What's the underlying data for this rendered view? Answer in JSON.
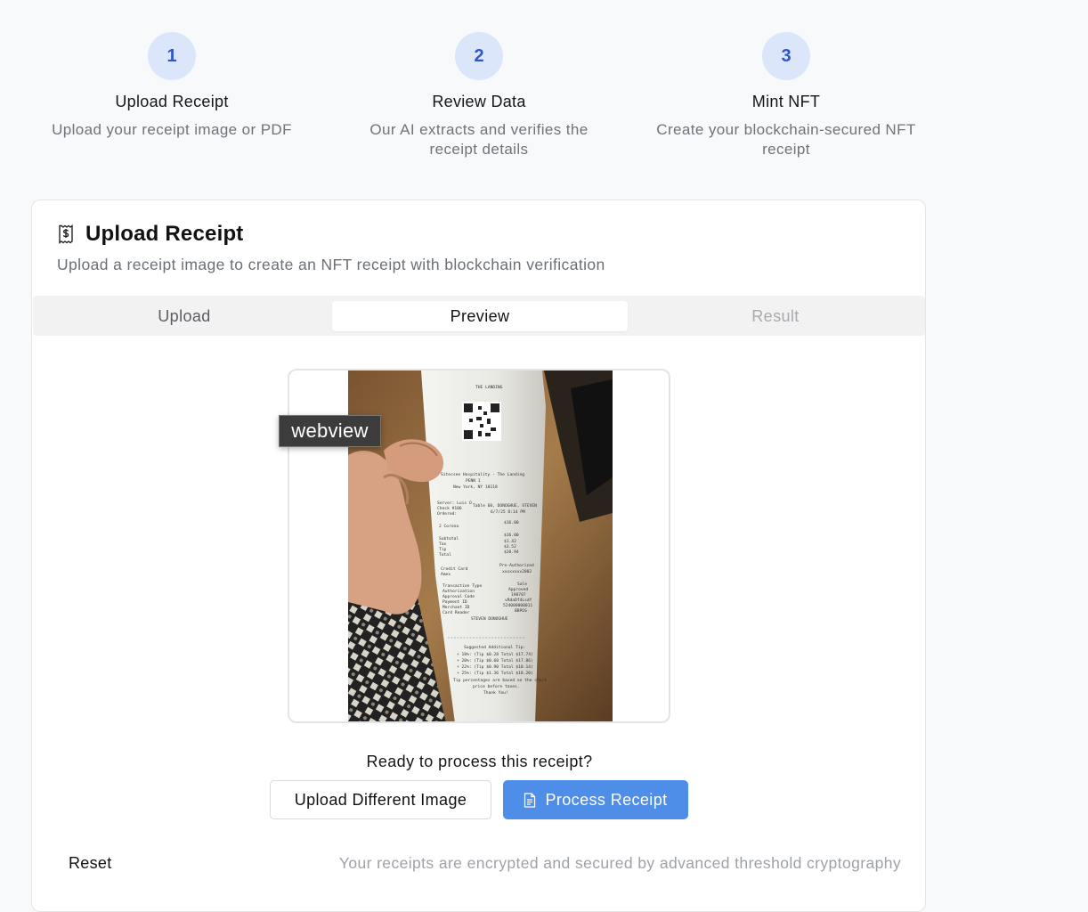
{
  "steps": [
    {
      "number": "1",
      "title": "Upload Receipt",
      "description": "Upload your receipt image or PDF"
    },
    {
      "number": "2",
      "title": "Review Data",
      "description": "Our AI extracts and verifies the receipt details"
    },
    {
      "number": "3",
      "title": "Mint NFT",
      "description": "Create your blockchain-secured NFT receipt"
    }
  ],
  "card": {
    "icon": "receipt-icon",
    "title": "Upload Receipt",
    "subtitle": "Upload a receipt image to create an NFT receipt with blockchain verification"
  },
  "tabs": [
    {
      "label": "Upload",
      "state": "inactive"
    },
    {
      "label": "Preview",
      "state": "active"
    },
    {
      "label": "Result",
      "state": "disabled"
    }
  ],
  "tooltip": "webview",
  "receipt_photo": {
    "header": "THE LANDING",
    "lines": [
      "Sitecsee Hospitality - The Landing",
      "PENN 1",
      "New York, NY 10118",
      "Server: Luis O",
      "Check #186",
      "Table 60, DONOGHUE, STEVEN",
      "Ordered:",
      "6/7/25 8:14 PM",
      "2 Corona",
      "$16.00",
      "Subtotal",
      "$16.00",
      "Tax",
      "$1.42",
      "Tip",
      "$3.52",
      "Total",
      "$20.94",
      "Credit Card",
      "Pre-Authorized",
      "Amex",
      "xxxxxxxx2002",
      "Transaction Type",
      "Sale",
      "Authorization",
      "Approved",
      "Approval Code",
      "198707",
      "Payment ID",
      "vRdaDf4Lsdf",
      "Merchant ID",
      "524000000011",
      "Card Reader",
      "BBPOS",
      "STEVEN DONOGHUE",
      "Suggested Additional Tip:",
      "+ 18%: (Tip $0.28 Total $17.74)",
      "+ 20%: (Tip $0.60 Total $17.86)",
      "+ 22%: (Tip $0.90 Total $18.14)",
      "+ 25%: (Tip $1.36 Total $18.20)",
      "Tip percentages are based on the check",
      "price before taxes.",
      "Thank You!"
    ]
  },
  "prompt": "Ready to process this receipt?",
  "buttons": {
    "upload_different": "Upload Different Image",
    "process": "Process Receipt",
    "process_icon": "document-icon"
  },
  "reset_label": "Reset",
  "footer_note": "Your receipts are encrypted and secured by advanced threshold cryptography",
  "colors": {
    "accent": "#4e8ee9",
    "step_circle_bg": "#dbe6fb",
    "step_number": "#2f56c8"
  }
}
